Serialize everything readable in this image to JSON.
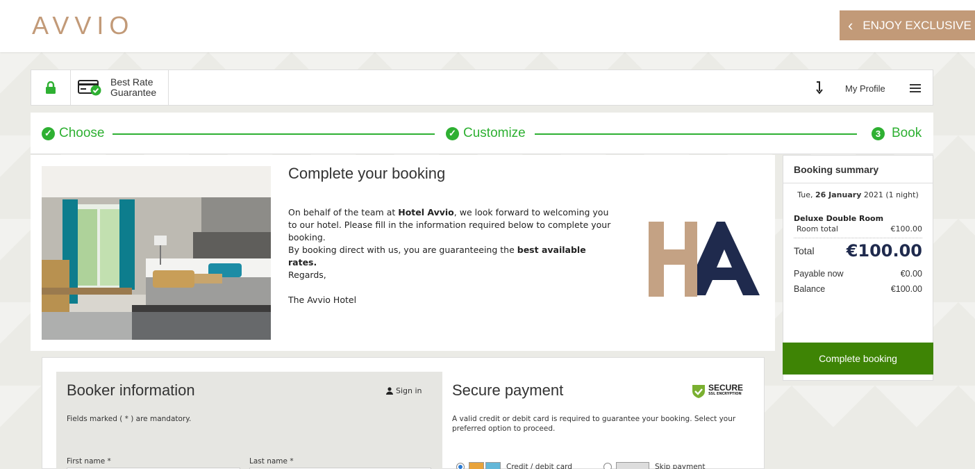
{
  "header": {
    "logo": "AVVIO",
    "promo": "ENJOY EXCLUSIVE BE",
    "brand_color": "#c29a78"
  },
  "topbar": {
    "brg_line1": "Best Rate",
    "brg_line2": "Guarantee",
    "profile": "My Profile"
  },
  "steps": {
    "choose": "Choose",
    "customize": "Customize",
    "book": "Book",
    "book_number": "3",
    "color": "#2eb032"
  },
  "intro": {
    "title": "Complete your booking",
    "p1_pre": "On behalf of the team at ",
    "p1_hotel": "Hotel Avvio",
    "p1_post": ", we look forward to welcoming you to our hotel. Please fill in the information required below to complete your booking.",
    "p2_pre": "By booking direct with us, you are guaranteeing the ",
    "p2_bold": "best available rates.",
    "regards": "Regards,",
    "signoff": "The Avvio Hotel"
  },
  "summary": {
    "title": "Booking summary",
    "date_pre": "Tue, ",
    "date_bold": "26 January",
    "date_post": " 2021 (1 night)",
    "room_name": "Deluxe Double Room",
    "room_total_label": "Room total",
    "room_total_value": "€100.00",
    "total_label": "Total",
    "total_value": "€100.00",
    "payable_label": "Payable now",
    "payable_value": "€0.00",
    "balance_label": "Balance",
    "balance_value": "€100.00",
    "button": "Complete booking",
    "button_color": "#3e8405"
  },
  "booker": {
    "title": "Booker information",
    "signin": "Sign in",
    "mandatory": "Fields marked ( * ) are mandatory.",
    "first_name": "First name *",
    "last_name": "Last name *"
  },
  "payment": {
    "title": "Secure payment",
    "badge_top": "SECURE",
    "badge_bottom": "SSL ENCRYPTION",
    "note": "A valid credit or debit card is required to guarantee your booking. Select your preferred option to proceed.",
    "option1": "Credit / debit card",
    "option2": "Skip payment"
  }
}
